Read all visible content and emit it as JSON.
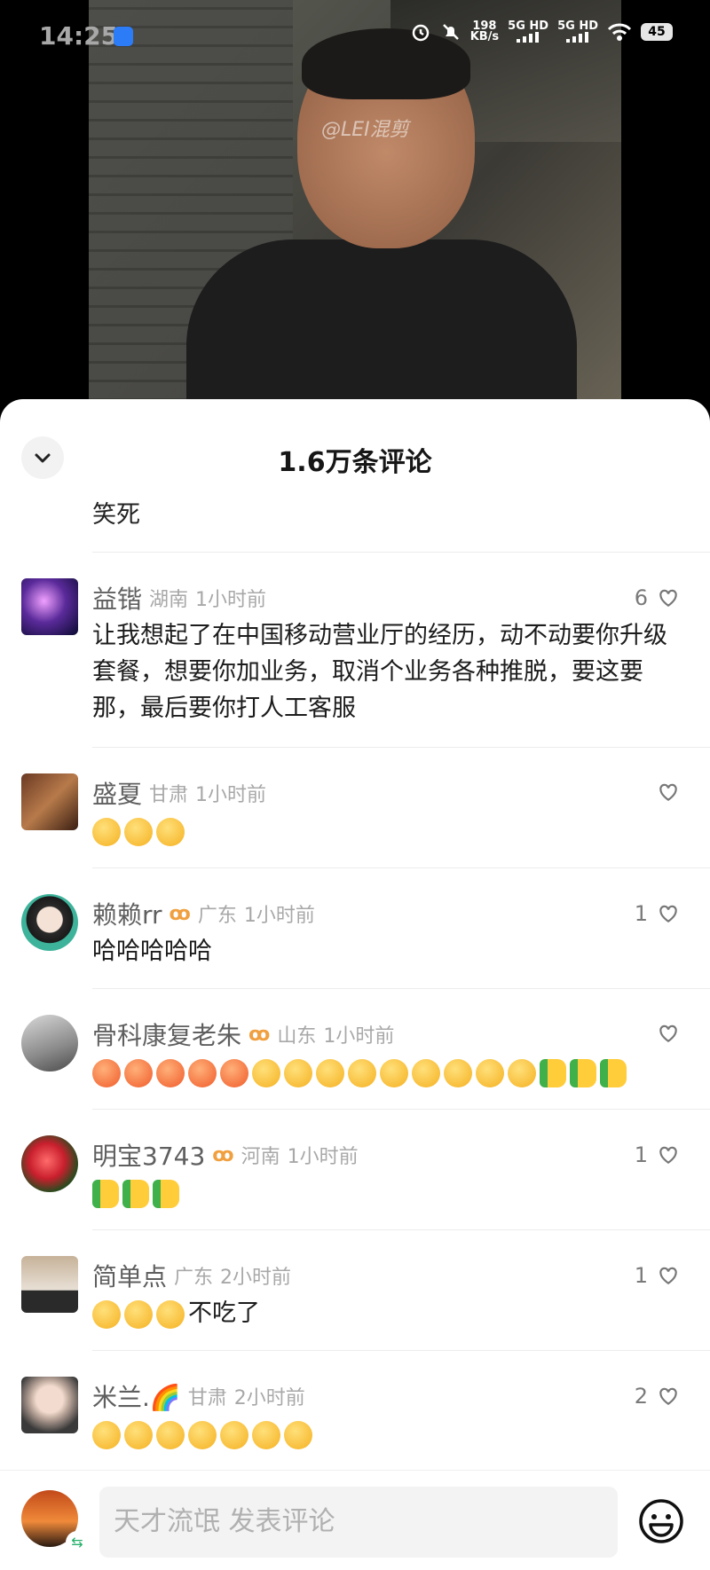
{
  "status_bar": {
    "time": "14:25",
    "net_speed_value": "198",
    "net_speed_unit": "KB/s",
    "sim1": "5G HD",
    "sim2": "5G HD",
    "battery": "45"
  },
  "video": {
    "watermark": "@LEI混剪"
  },
  "sheet": {
    "title": "1.6万条评论",
    "previous_comment_tail": "笑死"
  },
  "comments": [
    {
      "user": "益锴",
      "region": "湖南",
      "time": "1小时前",
      "likes": "6",
      "text": "让我想起了在中国移动营业厅的经历，动不动要你升级套餐，想要你加业务，取消个业务各种推脱，要这要那，最后要你打人工客服"
    },
    {
      "user": "盛夏",
      "region": "甘肃",
      "time": "1小时前",
      "likes": "",
      "emojis": [
        "grin",
        "grin",
        "grin"
      ]
    },
    {
      "user": "赖赖rr",
      "region": "广东",
      "time": "1小时前",
      "likes": "1",
      "text": "哈哈哈哈哈",
      "badge": "ꝏ"
    },
    {
      "user": "骨科康复老朱",
      "region": "山东",
      "time": "1小时前",
      "likes": "",
      "badge": "ꝏ",
      "emojis": [
        "angry",
        "angry",
        "angry",
        "angry",
        "angry",
        "laughcry",
        "laughcry",
        "laughcry",
        "laughcry",
        "666",
        "666",
        "666",
        "666",
        "666",
        "thumb",
        "thumb",
        "thumb"
      ]
    },
    {
      "user": "明宝3743",
      "region": "河南",
      "time": "1小时前",
      "likes": "1",
      "badge": "ꝏ",
      "emojis": [
        "thumb",
        "thumb",
        "thumb"
      ]
    },
    {
      "user": "简单点",
      "region": "广东",
      "time": "2小时前",
      "likes": "1",
      "emojis": [
        "laughcry",
        "laughcry",
        "laughcry"
      ],
      "text_after": "不吃了"
    },
    {
      "user": "米兰.🌈",
      "region": "甘肃",
      "time": "2小时前",
      "likes": "2",
      "emojis": [
        "laughcry",
        "laughcry",
        "laughcry",
        "laughcry",
        "laughcry",
        "laughcry",
        "laughcry"
      ]
    }
  ],
  "input": {
    "placeholder": "天才流氓 发表评论"
  },
  "icons": {
    "collapse": "chevron-down-icon",
    "like": "heart-outline-icon",
    "emoji": "smiley-icon",
    "swap": "swap-icon"
  }
}
